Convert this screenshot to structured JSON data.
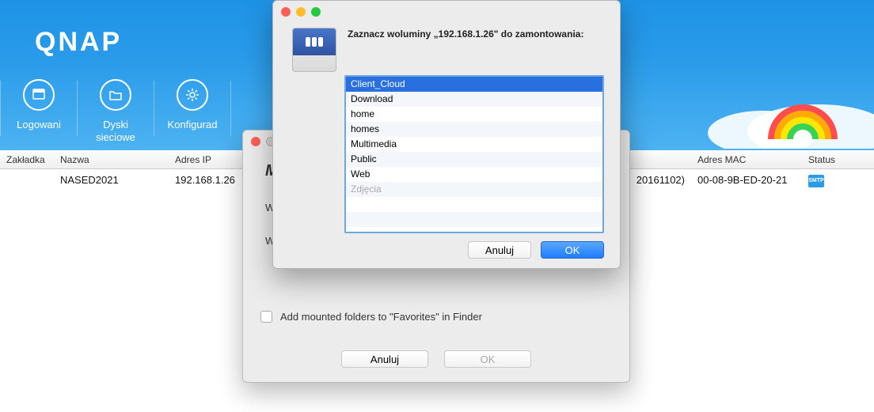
{
  "brand": "QNAP",
  "nav": {
    "item1": "Logowani",
    "item2_line1": "Dyski",
    "item2_line2": "sieciowe",
    "item3": "Konfigurad"
  },
  "table": {
    "headers": {
      "zakladka": "Zakładka",
      "nazwa": "Nazwa",
      "adresip": "Adres IP",
      "mac": "Adres MAC",
      "status": "Status"
    },
    "row": {
      "nazwa": "NASED2021",
      "ip": "192.168.1.26",
      "ip_tail": "20161102)",
      "mac": "00-08-9B-ED-20-21",
      "status_badge": "SMTP"
    }
  },
  "mid": {
    "title_partial": "M",
    "line1": "Wy",
    "line2": "Wy",
    "checkbox_label": "Add mounted folders to \"Favorites\" in Finder",
    "cancel": "Anuluj",
    "ok": "OK"
  },
  "dialog": {
    "prompt": "Zaznacz woluminy „192.168.1.26\" do zamontowania:",
    "volumes": [
      {
        "name": "Client_Cloud",
        "selected": true,
        "disabled": false
      },
      {
        "name": "Download",
        "selected": false,
        "disabled": false
      },
      {
        "name": "home",
        "selected": false,
        "disabled": false
      },
      {
        "name": "homes",
        "selected": false,
        "disabled": false
      },
      {
        "name": "Multimedia",
        "selected": false,
        "disabled": false
      },
      {
        "name": "Public",
        "selected": false,
        "disabled": false
      },
      {
        "name": "Web",
        "selected": false,
        "disabled": false
      },
      {
        "name": "Zdjęcia",
        "selected": false,
        "disabled": true
      }
    ],
    "cancel": "Anuluj",
    "ok": "OK"
  }
}
